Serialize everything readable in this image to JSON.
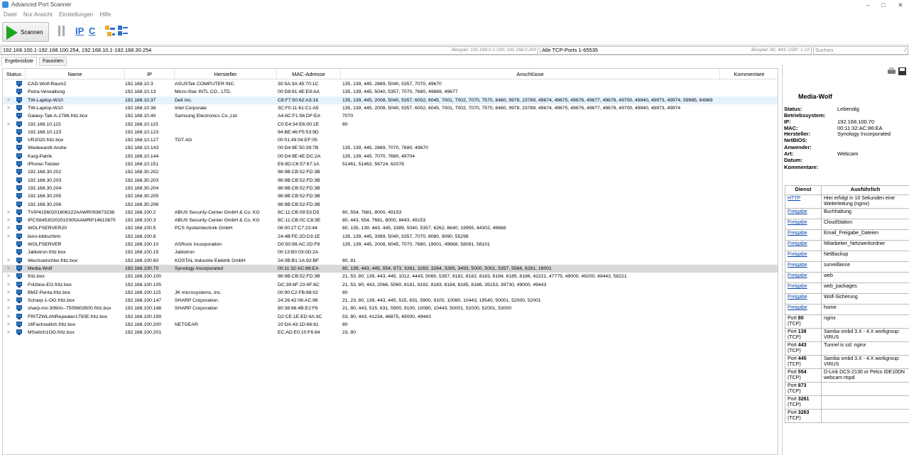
{
  "app": {
    "title": "Advanced Port Scanner"
  },
  "menu": [
    "Datei",
    "Nur Ansicht",
    "Einstellungen",
    "Hilfe"
  ],
  "toolbar": {
    "scan_label": "Scannen",
    "ip_label": "IP",
    "c_label": "C"
  },
  "range": {
    "ip_value": "192.168.100.1-192.168.100.254, 192.168.10.1-192.168.30.254",
    "ip_placeholder": "Beispiel: 192.168.0.1-100, 192.168.0.200",
    "ports_value": "Alle TCP-Ports 1-65535",
    "ports_placeholder": "Beispiel: 80, 443, UDP: 1-10",
    "search_placeholder": "Suchen"
  },
  "tabs": [
    "Ergebnisliste",
    "Favoriten"
  ],
  "columns": [
    "Status",
    "Name",
    "IP",
    "Hersteller",
    "MAC-Adresse",
    "Anschlüsse",
    "Kommentare"
  ],
  "rows": [
    {
      "exp": "",
      "name": "CAD-Wolf-Raum2",
      "ip": "192.168.10.3",
      "vendor": "ASUSTek COMPUTER INC.",
      "mac": "30:5A:3A:45:70:1C",
      "ports": "135, 139, 445, 2869, 5040, 5357, 7070, 49670"
    },
    {
      "exp": "",
      "name": "Petra-Verwaltung",
      "ip": "192.168.10.13",
      "vendor": "Micro-Star INTL CO., LTD.",
      "mac": "00:D8:61:4E:E9:AA",
      "ports": "135, 139, 445, 5040, 5357, 7070, 7680, 49669, 49677"
    },
    {
      "exp": ">",
      "name": "TW-Laptop-W10",
      "ip": "192.168.10.37",
      "vendor": "Dell Inc.",
      "mac": "C8:F7:50:62:A3:16",
      "ports": "135, 139, 445, 2008, 5040, 5357, 6002, 6045, 7001, 7002, 7070, 7570, 8460, 9978, 23789, 49674, 49675, 49676, 49677, 49678, 49700, 49940, 49973, 49974, 59985, 64969",
      "hl": "blue"
    },
    {
      "exp": ">",
      "name": "TW-Laptop-W10",
      "ip": "192.168.10.38",
      "vendor": "Intel Corporate",
      "mac": "3C:F0:11:61:C1:A5",
      "ports": "135, 139, 445, 2008, 5040, 5357, 6002, 6045, 7001, 7002, 7070, 7570, 8460, 9978, 23789, 49674, 49675, 49676, 49677, 49678, 49700, 49940, 49973, 49974"
    },
    {
      "exp": "",
      "name": "Galaxy-Tab-A-2786.fritz.box",
      "ip": "192.168.10.40",
      "vendor": "Samsung Electronics Co.,Ltd",
      "mac": "A4:6C:F1:56:DF:EA",
      "ports": "7070"
    },
    {
      "exp": ">",
      "name": "192.168.10.115",
      "ip": "192.168.10.115",
      "vendor": "",
      "mac": "C0:E4:34:E6:00:1E",
      "ports": "80"
    },
    {
      "exp": "",
      "name": "192.168.10.123",
      "ip": "192.168.10.123",
      "vendor": "",
      "mac": "94:BE:46:F5:53:9D",
      "ports": ""
    },
    {
      "exp": "",
      "name": "VR2020.fritz.box",
      "ip": "192.168.10.127",
      "vendor": "TDT AG",
      "mac": "00:01:49:04:EF:05",
      "ports": ""
    },
    {
      "exp": "",
      "name": "Wedewardt-Andre",
      "ip": "192.168.10.143",
      "vendor": "",
      "mac": "00:D4:9E:50:39:7B",
      "ports": "135, 139, 445, 2869, 7070, 7680, 49670"
    },
    {
      "exp": "",
      "name": "Karg-Patrik",
      "ip": "192.168.10.144",
      "vendor": "",
      "mac": "00:D4:9E:4E:DC:2A",
      "ports": "135, 139, 445, 7070, 7680, 49704"
    },
    {
      "exp": "",
      "name": "iPhone-Twister",
      "ip": "192.168.10.151",
      "vendor": "",
      "mac": "E6:8D:C6:57:67:1A",
      "ports": "51461, 51462, 56724, 62078"
    },
    {
      "exp": "",
      "name": "192.168.30.202",
      "ip": "192.168.30.202",
      "vendor": "",
      "mac": "98:9B:CB:52:FD:3B",
      "ports": ""
    },
    {
      "exp": "",
      "name": "192.168.30.203",
      "ip": "192.168.30.203",
      "vendor": "",
      "mac": "98:9B:CB:52:FD:3B",
      "ports": ""
    },
    {
      "exp": "",
      "name": "192.168.30.204",
      "ip": "192.168.30.204",
      "vendor": "",
      "mac": "98:9B:CB:52:FD:3B",
      "ports": ""
    },
    {
      "exp": "",
      "name": "192.168.30.205",
      "ip": "192.168.30.205",
      "vendor": "",
      "mac": "98:9B:CB:52:FD:3B",
      "ports": ""
    },
    {
      "exp": "",
      "name": "192.168.30.206",
      "ip": "192.168.30.206",
      "vendor": "",
      "mac": "98:9B:CB:52:FD:3B",
      "ports": ""
    },
    {
      "exp": ">",
      "name": "TVIP41560201606222AAWR093673236",
      "ip": "192.168.100.2",
      "vendor": "ABUS Security-Center GmbH & Co. KG",
      "mac": "8C:11:CB:09:53:D5",
      "ports": "80, 554, 7681, 8000, 49153"
    },
    {
      "exp": ">",
      "name": "IPCS84530202010300AAWRP14610870",
      "ip": "192.168.100.3",
      "vendor": "ABUS Security-Center GmbH & Co. KG",
      "mac": "8C:11:CB:0C:C8:3E",
      "ports": "80, 443, 554, 7681, 8000, 8443, 49153"
    },
    {
      "exp": ">",
      "name": "WOLFSERVER20",
      "ip": "192.168.100.5",
      "vendor": "PCS Systemtechnik GmbH",
      "mac": "08:00:27:C7:23:44",
      "ports": "80, 135, 139, 443, 445, 3389, 5040, 5357, 6262, 8640, 19955, 44302, 49668"
    },
    {
      "exp": ">",
      "name": "büro-bildschirm",
      "ip": "192.168.100.8",
      "vendor": "",
      "mac": "24:4B:FE:2D:D3:1E",
      "ports": "135, 139, 445, 3389, 5040, 5357, 7070, 8080, 9090, 55298"
    },
    {
      "exp": "",
      "name": "WOLFSERVER",
      "ip": "192.168.100.10",
      "vendor": "ASRock Incorporation",
      "mac": "D0:50:99:AC:2D:F8",
      "ports": "135, 139, 445, 2008, 6045, 7070, 7680, 19001, 49668, 58091, 58101"
    },
    {
      "exp": "",
      "name": "Jablotron.fritz.box",
      "ip": "192.168.100.15",
      "vendor": "Jablotron",
      "mac": "00:13:B0:03:0D:2A",
      "ports": ""
    },
    {
      "exp": ">",
      "name": "Wechselrichter.fritz.box",
      "ip": "192.168.100.60",
      "vendor": "KOSTAL Industrie Elektrik GmbH",
      "mac": "24:0B:B1:1A:92:BF",
      "ports": "80, 81"
    },
    {
      "exp": ">",
      "name": "Media-Wolf",
      "ip": "192.168.100.70",
      "vendor": "Synology Incorporated",
      "mac": "00:11:32:AC:86:EA",
      "ports": "80, 139, 443, 445, 554, 873, 3261, 3263, 3264, 3265, 3493, 5000, 5001, 5357, 5566, 6281, 18001",
      "hl": "gray"
    },
    {
      "exp": ">",
      "name": "fritz.box",
      "ip": "192.168.100.100",
      "vendor": "",
      "mac": "98:9B:CB:52:FD:3B",
      "ports": "21, 53, 80, 139, 443, 445, 1012, 4443, 5060, 5357, 8181, 8182, 8183, 8184, 8185, 8186, 42221, 47775, 49000, 49200, 49443, 58221"
    },
    {
      "exp": ">",
      "name": "Fritzbox-EG.fritz.box",
      "ip": "192.168.100.105",
      "vendor": "",
      "mac": "DC:39:6F:23:4F:6C",
      "ports": "21, 53, 80, 443, 2066, 5060, 8181, 8182, 8183, 8184, 8185, 8186, 35153, 39730, 49000, 49443"
    },
    {
      "exp": ">",
      "name": "BMZ-Penta.fritz.box",
      "ip": "192.168.100.115",
      "vendor": "JK microsystems, Inc.",
      "mac": "00:90:C2:FB:68:02",
      "ports": "80"
    },
    {
      "exp": ">",
      "name": "Scharp-1-OG.fritz.box",
      "ip": "192.168.100.147",
      "vendor": "SHARP Corporation.",
      "mac": "24:26:42:06:AC:96",
      "ports": "21, 23, 80, 139, 443, 445, 515, 631, 5900, 9100, 10080, 10443, 19540, 50001, 52000, 52001"
    },
    {
      "exp": ">",
      "name": "sharp-mx-3060n--7505603500.fritz.box",
      "ip": "192.168.100.148",
      "vendor": "SHARP Corporation",
      "mac": "80:38:96:4B:E2:F6",
      "ports": "21, 80, 443, 515, 631, 5900, 9100, 10080, 10443, 50001, 52000, 52001, 53000"
    },
    {
      "exp": ">",
      "name": "FRITZWLANRepeater1750E.fritz.box",
      "ip": "192.168.100.199",
      "vendor": "",
      "mac": "D2:CE:1E:ED:4A:3C",
      "ports": "53, 80, 443, 41234, 46875, 49000, 49443"
    },
    {
      "exp": ">",
      "name": "16Fachswitch.fritz.box",
      "ip": "192.168.100.200",
      "vendor": "NETGEAR",
      "mac": "10:DA:43:1D:66:81",
      "ports": "80"
    },
    {
      "exp": ">",
      "name": "MSwitch1OG.fritz.box",
      "ip": "192.168.100.201",
      "vendor": "",
      "mac": "EC:AD:E0:10:F6:84",
      "ports": "23, 80"
    }
  ],
  "panel": {
    "device_name": "Media-Wolf",
    "info": [
      {
        "k": "Status:",
        "v": "Lebendig"
      },
      {
        "k": "Betriebssystem:",
        "v": ""
      },
      {
        "k": "IP:",
        "v": "192.168.100.70"
      },
      {
        "k": "MAC:",
        "v": "00:11:32:AC:86:EA"
      },
      {
        "k": "Hersteller:",
        "v": "Synology Incorporated"
      },
      {
        "k": "NetBIOS:",
        "v": ""
      },
      {
        "k": "Anwender:",
        "v": ""
      },
      {
        "k": "Art:",
        "v": "Webcam"
      },
      {
        "k": "Datum:",
        "v": ""
      },
      {
        "k": "Kommentare:",
        "v": ""
      }
    ],
    "service_headers": [
      "Dienst",
      "Ausführlich"
    ],
    "services": [
      {
        "svc": "HTTP",
        "link": true,
        "detail": "Hier erfolgt in 10 Sekunden eine Weiterleitung (nginx)"
      },
      {
        "svc": "Freigabe",
        "link": true,
        "detail": "Buchhaltung"
      },
      {
        "svc": "Freigabe",
        "link": true,
        "detail": "CloudStation"
      },
      {
        "svc": "Freigabe",
        "link": true,
        "detail": "Email_Freigabe_Dateien"
      },
      {
        "svc": "Freigabe",
        "link": true,
        "detail": "Mitarbeiter_Netzwerkordner"
      },
      {
        "svc": "Freigabe",
        "link": true,
        "detail": "NetBackup"
      },
      {
        "svc": "Freigabe",
        "link": true,
        "detail": "surveillance"
      },
      {
        "svc": "Freigabe",
        "link": true,
        "detail": "web"
      },
      {
        "svc": "Freigabe",
        "link": true,
        "detail": "web_packages"
      },
      {
        "svc": "Freigabe",
        "link": true,
        "detail": "Wolf-Sicherung"
      },
      {
        "svc": "Freigabe",
        "link": true,
        "detail": "home"
      },
      {
        "svc": "Port 80 (TCP)",
        "port": "80",
        "link": false,
        "detail": "nginx"
      },
      {
        "svc": "Port 139 (TCP)",
        "port": "139",
        "link": false,
        "detail": "Samba smbd 3.X - 4.X workgroup: VIRUS"
      },
      {
        "svc": "Port 443 (TCP)",
        "port": "443",
        "link": false,
        "detail": "Tunnel is ssl: nginx"
      },
      {
        "svc": "Port 445 (TCP)",
        "port": "445",
        "link": false,
        "detail": "Samba smbd 3.X - 4.X workgroup: VIRUS"
      },
      {
        "svc": "Port 554 (TCP)",
        "port": "554",
        "link": false,
        "detail": "D-Link DCS-2130 or Pelco IDE10DN webcam rtspd"
      },
      {
        "svc": "Port 873 (TCP)",
        "port": "873",
        "link": false,
        "detail": ""
      },
      {
        "svc": "Port 3261 (TCP)",
        "port": "3261",
        "link": false,
        "detail": ""
      },
      {
        "svc": "Port 3263 (TCP)",
        "port": "3263",
        "link": false,
        "detail": ""
      }
    ]
  },
  "colors": {
    "accent_green": "#1ea51e",
    "selected_blue": "#e5f1fb",
    "selected_gray": "#d9d9d9",
    "link": "#0645ad"
  }
}
